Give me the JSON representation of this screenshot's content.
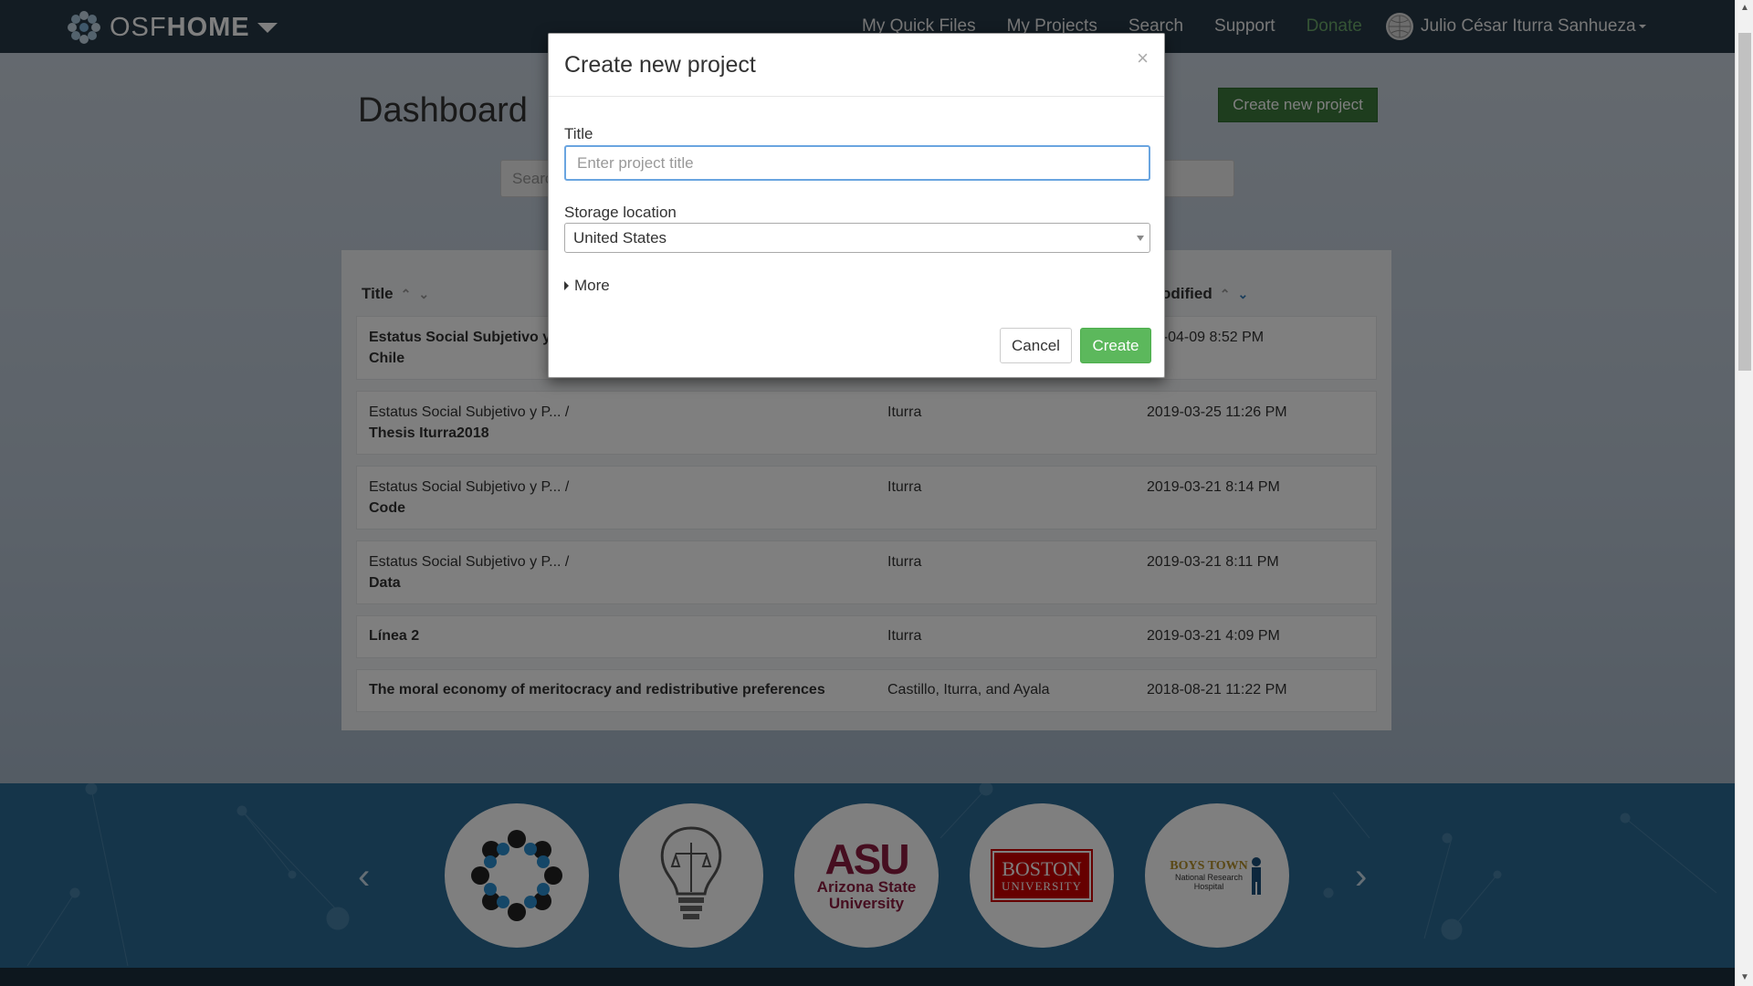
{
  "navbar": {
    "brand_prefix": "OSF",
    "brand_suffix": "HOME",
    "links": [
      "My Quick Files",
      "My Projects",
      "Search",
      "Support",
      "Donate"
    ],
    "user_name": "Julio César Iturra Sanhueza"
  },
  "dashboard": {
    "title": "Dashboard",
    "create_button": "Create new project",
    "search_placeholder": "Searc"
  },
  "projects": {
    "columns": {
      "title": "Title",
      "modified": "odified"
    },
    "rows": [
      {
        "line1": "Estatus Social Subjetivo y",
        "line2": "Chile",
        "contributors": "",
        "modified": "19-04-09 8:52 PM"
      },
      {
        "line1": "Estatus Social Subjetivo y P...   /",
        "line2": "Thesis Iturra2018",
        "contributors": "Iturra",
        "modified": "2019-03-25 11:26 PM"
      },
      {
        "line1": "Estatus Social Subjetivo y P...   /",
        "line2": "Code",
        "contributors": "Iturra",
        "modified": "2019-03-21 8:14 PM"
      },
      {
        "line1": "Estatus Social Subjetivo y P...   /",
        "line2": "Data",
        "contributors": "Iturra",
        "modified": "2019-03-21 8:11 PM"
      },
      {
        "line1": "",
        "line2": "Línea 2",
        "contributors": "Iturra",
        "modified": "2019-03-21 4:09 PM"
      },
      {
        "line1": "",
        "line2": "The moral economy of meritocracy and redistributive preferences",
        "contributors": "Castillo, Iturra, and Ayala",
        "modified": "2018-08-21 11:22 PM"
      }
    ]
  },
  "carousel": {
    "asu_line1": "ASU",
    "asu_line2": "Arizona State",
    "asu_line3": "University",
    "bu_line1": "BOSTON",
    "bu_line2": "UNIVERSITY",
    "boys_line1": "BOYS TOWN",
    "boys_line2": "National Research",
    "boys_line3": "Hospital"
  },
  "modal": {
    "title": "Create new project",
    "close": "×",
    "title_label": "Title",
    "title_placeholder": "Enter project title",
    "title_value": "",
    "storage_label": "Storage location",
    "storage_value": "United States",
    "more_label": "More",
    "cancel_label": "Cancel",
    "create_label": "Create"
  },
  "colors": {
    "navbar": "#263947",
    "create_green": "#5cb85c",
    "donate": "#6aa86a",
    "footer": "#2b6a94"
  }
}
